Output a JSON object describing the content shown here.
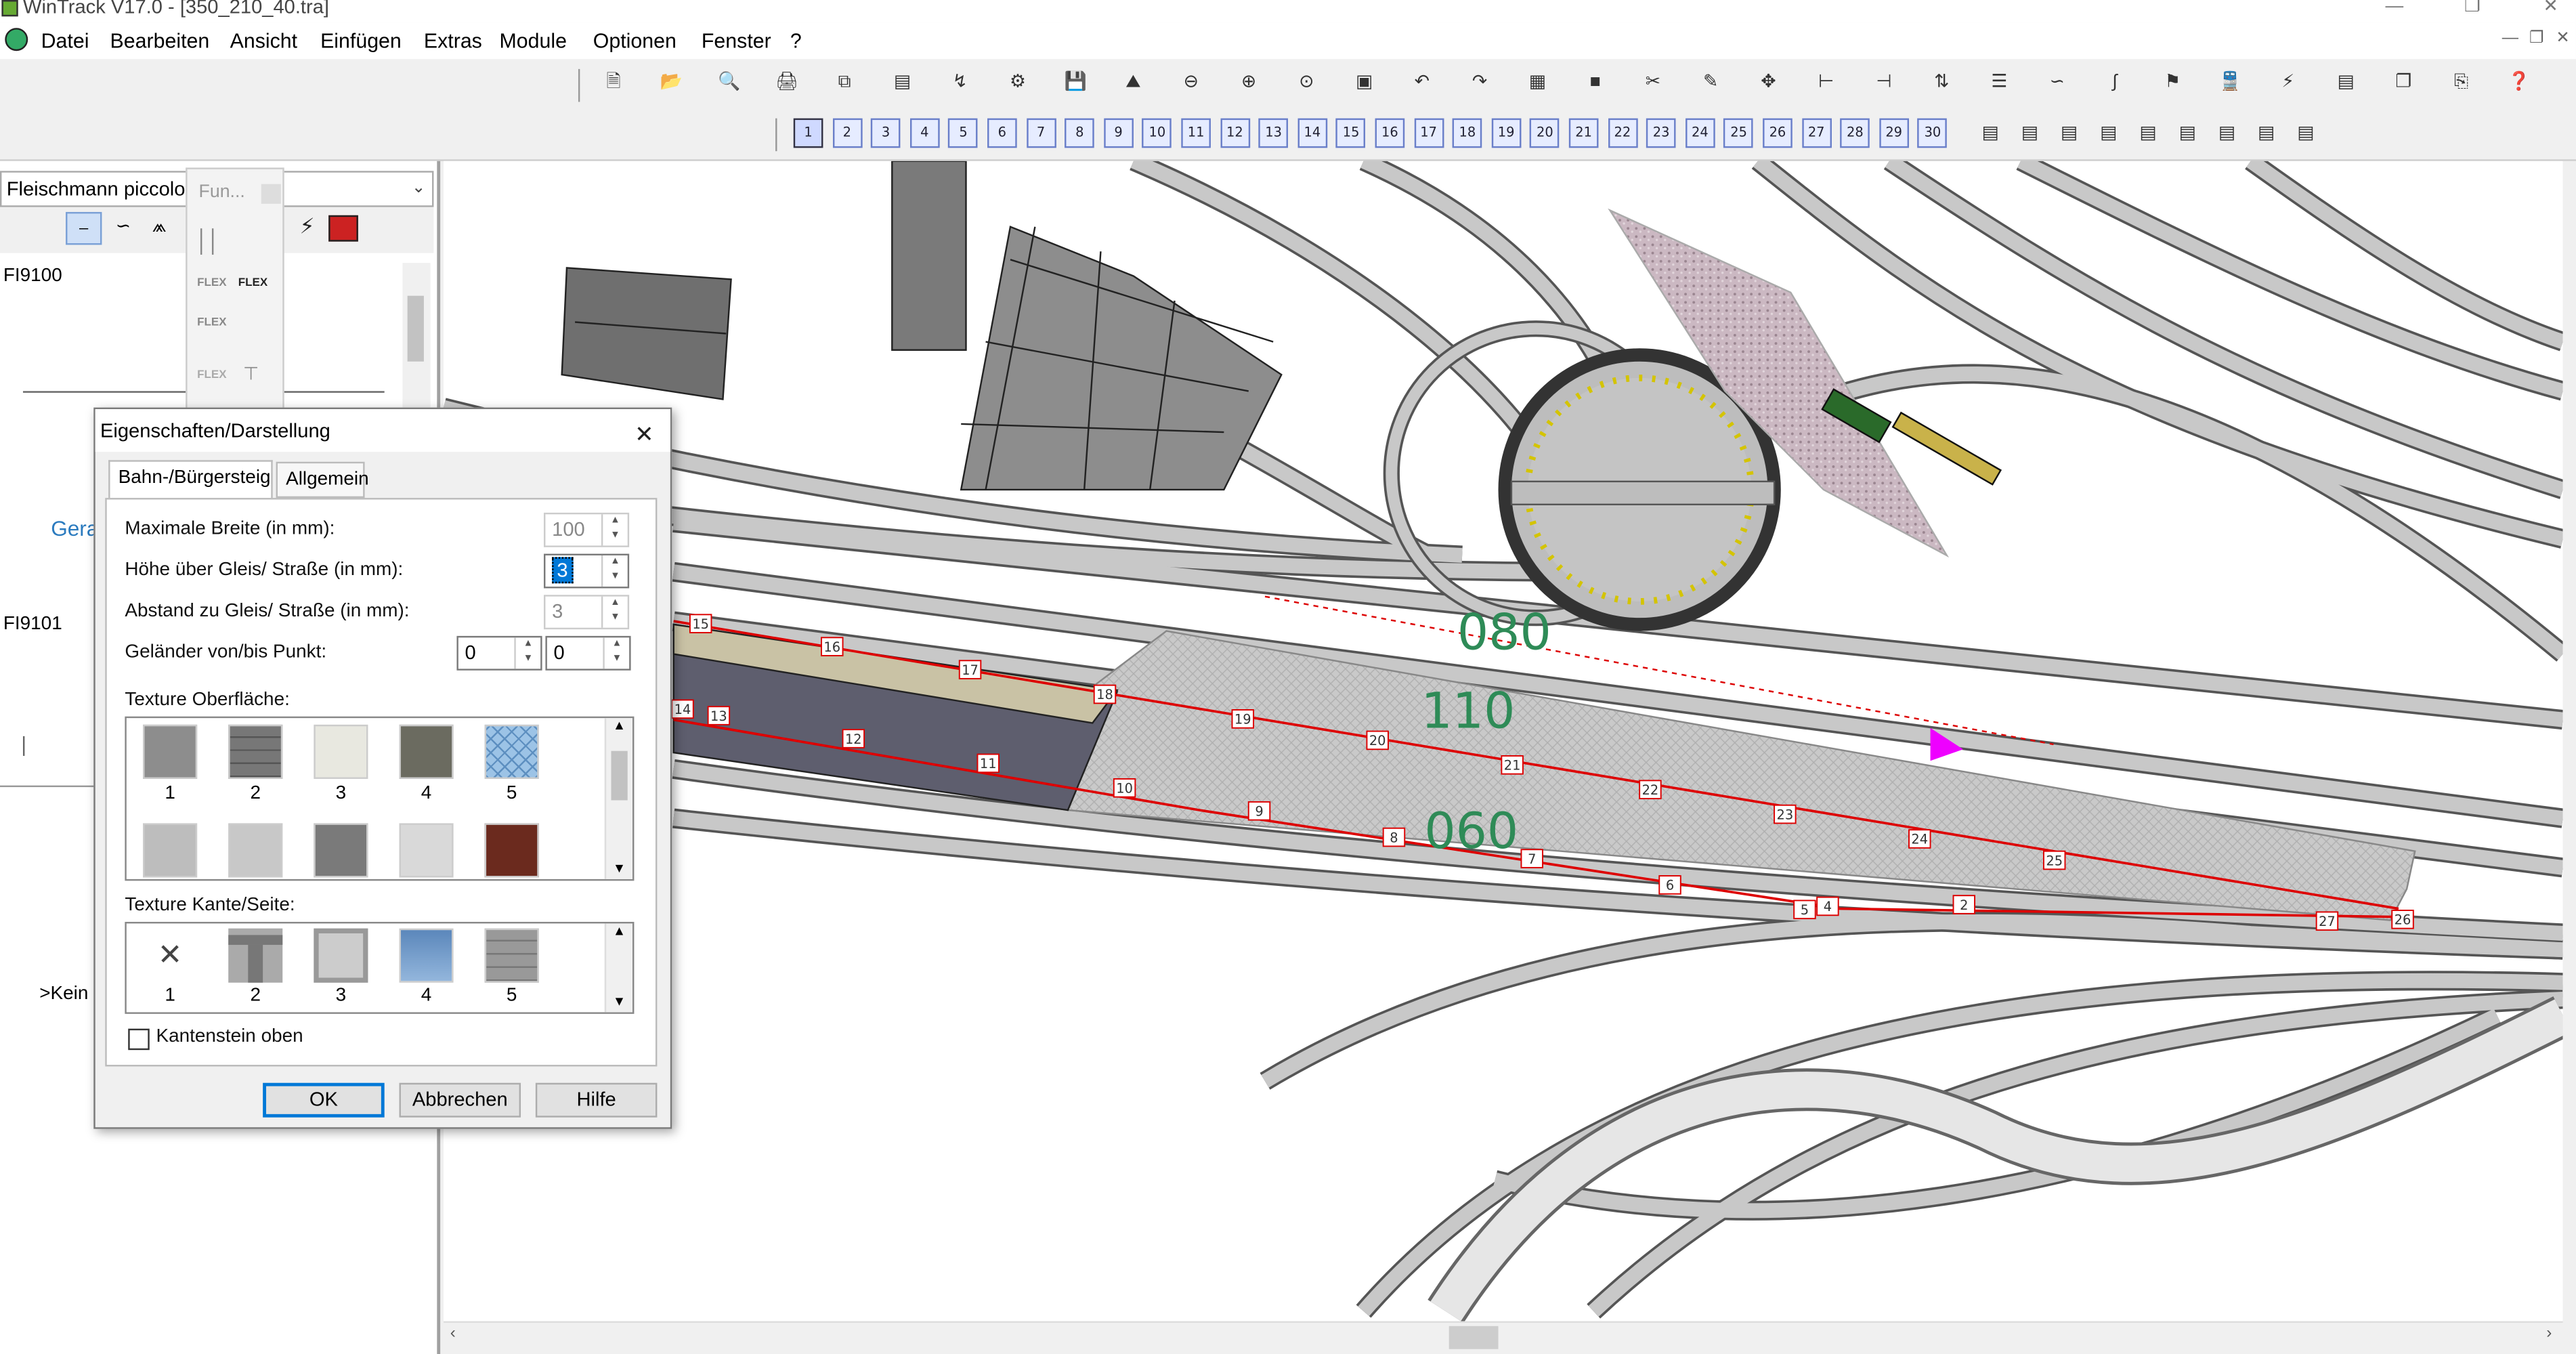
{
  "window": {
    "title": "WinTrack  V17.0 - [350_210_40.tra]"
  },
  "menu": [
    "Datei",
    "Bearbeiten",
    "Ansicht",
    "Einfügen",
    "Extras",
    "Module",
    "Optionen",
    "Fenster",
    "?"
  ],
  "toolbar": {
    "layer_numbers": [
      "1",
      "2",
      "3",
      "4",
      "5",
      "6",
      "7",
      "8",
      "9",
      "10",
      "11",
      "12",
      "13",
      "14",
      "15",
      "16",
      "17",
      "18",
      "19",
      "20",
      "21",
      "22",
      "23",
      "24",
      "25",
      "26",
      "27",
      "28",
      "29",
      "30"
    ],
    "active_layer": "1",
    "icons": [
      "new-icon",
      "open-icon",
      "print-preview-icon",
      "print-icon",
      "copy-window-icon",
      "page-icon",
      "export-icon",
      "settings-icon",
      "save-icon",
      "image-icon",
      "zoom-out-icon",
      "zoom-in-icon",
      "zoom-fit-icon",
      "zoom-window-icon",
      "undo-icon",
      "redo-icon",
      "grid-icon",
      "select-icon",
      "cut-icon",
      "pencil-icon",
      "move-icon",
      "connect-icon",
      "split-icon",
      "height-icon",
      "rail-icon",
      "flex-icon",
      "curve-icon",
      "signal-icon",
      "train-icon",
      "lightning-icon",
      "library-icon",
      "copy-icon",
      "paste-icon",
      "help-icon"
    ]
  },
  "left_panel": {
    "library_select": "Fleischmann piccolo-G",
    "function_box_label": "Fun...",
    "tree_item_1": "FI9100",
    "tree_item_2": "FI9101",
    "partial_label_geraet": "Gera",
    "partial_label_kein": ">Kein"
  },
  "dialog": {
    "title": "Eigenschaften/Darstellung",
    "tabs": [
      "Bahn-/Bürgersteig",
      "Allgemein"
    ],
    "active_tab": "Bahn-/Bürgersteig",
    "fields": {
      "max_width_label": "Maximale Breite (in mm):",
      "max_width_value": "100",
      "height_label": "Höhe über Gleis/ Straße (in mm):",
      "height_value": "3",
      "distance_label": "Abstand zu Gleis/ Straße (in mm):",
      "distance_value": "3",
      "railing_label": "Geländer von/bis Punkt:",
      "railing_from": "0",
      "railing_to": "0"
    },
    "texture_surface_label": "Texture Oberfläche:",
    "texture_surface_numbers": [
      "1",
      "2",
      "3",
      "4",
      "5"
    ],
    "texture_edge_label": "Texture Kante/Seite:",
    "texture_edge_numbers": [
      "1",
      "2",
      "3",
      "4",
      "5"
    ],
    "checkbox_label": "Kantenstein oben",
    "checkbox_checked": false,
    "buttons": {
      "ok": "OK",
      "cancel": "Abbrechen",
      "help": "Hilfe"
    }
  },
  "canvas": {
    "height_labels": [
      "080",
      "110",
      "060"
    ],
    "height_label_color": "#2e8b57",
    "platform_points": [
      "15",
      "16",
      "17",
      "18",
      "19",
      "20",
      "21",
      "22",
      "23",
      "24",
      "25",
      "26",
      "27",
      "14",
      "13",
      "12",
      "11",
      "10",
      "9",
      "8",
      "7",
      "6",
      "5",
      "4",
      "2"
    ]
  }
}
